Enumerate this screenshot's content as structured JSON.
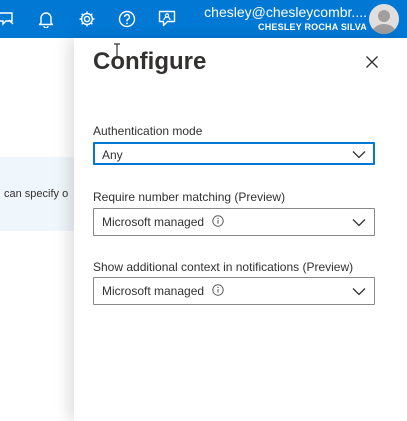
{
  "topbar": {
    "email": "chesley@chesleycombr....",
    "name": "CHESLEY ROCHA SILVA",
    "icons": [
      "feedback-icon",
      "bell-icon",
      "gear-icon",
      "help-icon",
      "chat-icon"
    ]
  },
  "background": {
    "text": "can specify o"
  },
  "panel": {
    "title": "Configure",
    "fields": [
      {
        "label": "Authentication mode",
        "value": "Any",
        "info": false
      },
      {
        "label": "Require number matching (Preview)",
        "value": "Microsoft managed",
        "info": true
      },
      {
        "label": "Show additional context in notifications (Preview)",
        "value": "Microsoft managed",
        "info": true
      }
    ]
  },
  "colors": {
    "accent": "#0078d4",
    "text": "#323130",
    "border": "#8a8886"
  }
}
